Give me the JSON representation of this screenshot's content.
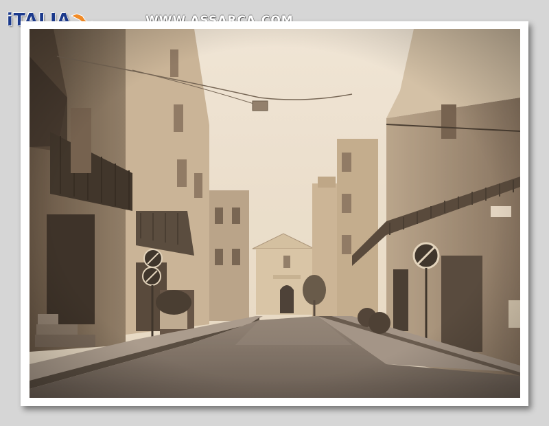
{
  "header": {
    "logo_text": "iTALIA",
    "logo_icon": "italy-map-icon",
    "site_url": "WWW.ASSARCA.COM"
  },
  "photo": {
    "subject": "street-scene",
    "accent_color": "#f28c28",
    "tone_color": "#e8dcc6"
  }
}
